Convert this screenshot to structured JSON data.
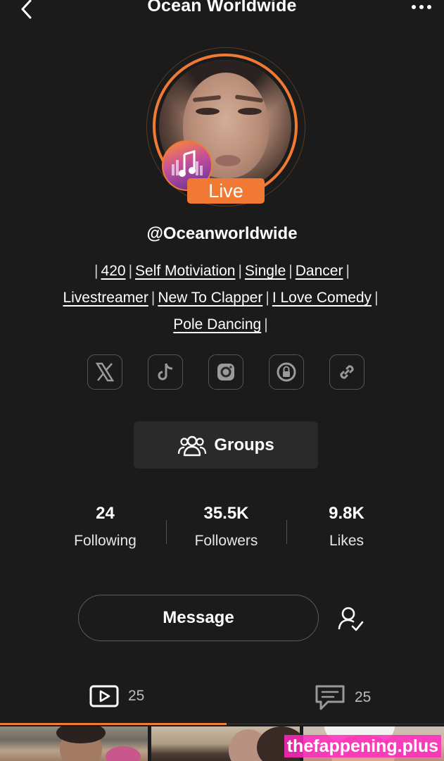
{
  "header": {
    "title": "Ocean Worldwide",
    "back_icon": "chevron-left-icon",
    "more_icon": "more-horizontal-icon"
  },
  "profile": {
    "live_label": "Live",
    "username": "@Oceanworldwide",
    "ring_color": "#f07a33",
    "bio_tags": [
      "420",
      "Self Motiviation",
      "Single",
      "Dancer",
      "Livestreamer",
      "New To Clapper",
      "I Love Comedy",
      "Pole Dancing"
    ],
    "bio_separator": "|"
  },
  "socials": [
    {
      "icon": "x-twitter-icon"
    },
    {
      "icon": "tiktok-icon"
    },
    {
      "icon": "instagram-icon"
    },
    {
      "icon": "onlyfans-lock-icon"
    },
    {
      "icon": "link-icon"
    }
  ],
  "groups": {
    "label": "Groups",
    "icon": "groups-icon"
  },
  "stats": [
    {
      "value": "24",
      "label": "Following"
    },
    {
      "value": "35.5K",
      "label": "Followers"
    },
    {
      "value": "9.8K",
      "label": "Likes"
    }
  ],
  "actions": {
    "message_label": "Message",
    "follow_icon": "user-check-icon"
  },
  "tabs": [
    {
      "icon": "video-icon",
      "count": "25",
      "active": true
    },
    {
      "icon": "comment-icon",
      "count": "25",
      "active": false
    }
  ],
  "watermark": "thefappening.plus",
  "colors": {
    "accent": "#f07a33",
    "background": "#1b1b1b"
  }
}
